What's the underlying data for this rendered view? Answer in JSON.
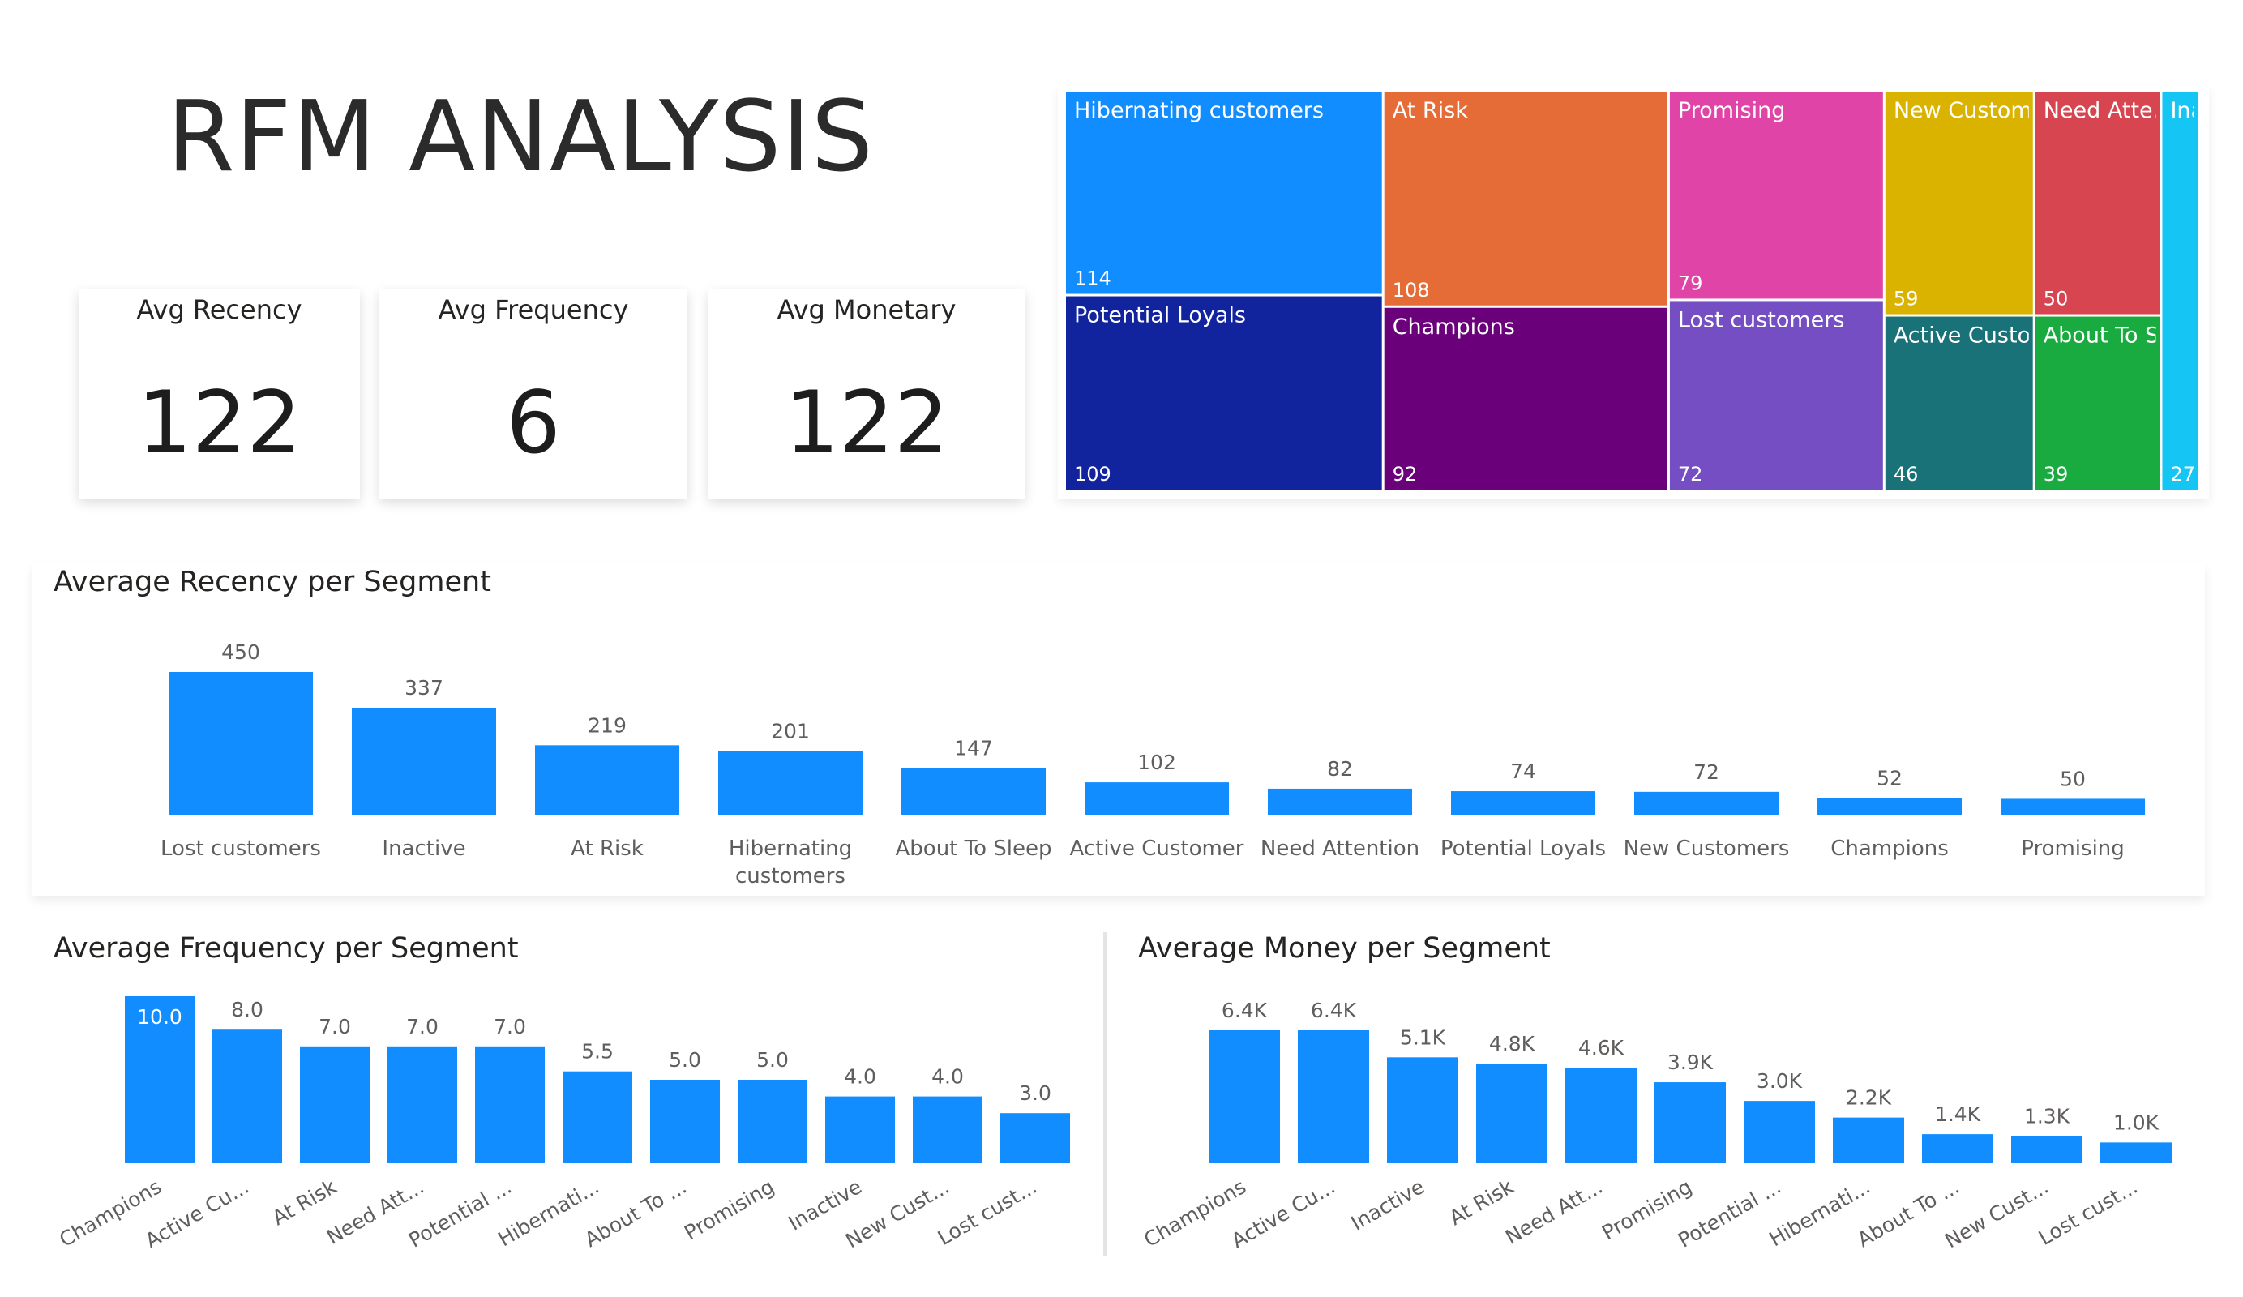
{
  "page": {
    "title": "RFM ANALYSIS"
  },
  "cards": [
    {
      "label": "Avg Recency",
      "value": "122"
    },
    {
      "label": "Avg Frequency",
      "value": "6"
    },
    {
      "label": "Avg Monetary",
      "value": "122"
    }
  ],
  "colors": {
    "bar": "#118DFF",
    "label": "#605E5C",
    "dark": "#252423"
  },
  "chart_data": [
    {
      "type": "treemap",
      "items": [
        {
          "label": "Hibernating customers",
          "value": 114,
          "color": "#118DFF"
        },
        {
          "label": "Potential Loyals",
          "value": 109,
          "color": "#12239E"
        },
        {
          "label": "At Risk",
          "value": 108,
          "color": "#E66C37"
        },
        {
          "label": "Champions",
          "value": 92,
          "color": "#6B007B"
        },
        {
          "label": "Promising",
          "value": 79,
          "color": "#E044A7"
        },
        {
          "label": "Lost customers",
          "value": 72,
          "color": "#744EC2"
        },
        {
          "label": "New Custom...",
          "value": 59,
          "color": "#D9B300"
        },
        {
          "label": "Need Atte...",
          "value": 50,
          "color": "#D64550"
        },
        {
          "label": "Active Customer",
          "value": 46,
          "color": "#197278"
        },
        {
          "label": "About To Sleep",
          "value": 39,
          "color": "#1AAB40"
        },
        {
          "label": "Inac...",
          "value": 27,
          "color": "#15C6F4"
        }
      ]
    },
    {
      "type": "bar",
      "title": "Average Recency per Segment",
      "categories": [
        [
          "Lost customers"
        ],
        [
          "Inactive"
        ],
        [
          "At Risk"
        ],
        [
          "Hibernating",
          "customers"
        ],
        [
          "About To Sleep"
        ],
        [
          "Active Customer"
        ],
        [
          "Need Attention"
        ],
        [
          "Potential Loyals"
        ],
        [
          "New Customers"
        ],
        [
          "Champions"
        ],
        [
          "Promising"
        ]
      ],
      "values": [
        450,
        337,
        219,
        201,
        147,
        102,
        82,
        74,
        72,
        52,
        50
      ],
      "labels": [
        "450",
        "337",
        "219",
        "201",
        "147",
        "102",
        "82",
        "74",
        "72",
        "52",
        "50"
      ]
    },
    {
      "type": "bar",
      "title": "Average Frequency per Segment",
      "categories": [
        "Champions",
        "Active Cu...",
        "At Risk",
        "Need Att...",
        "Potential ...",
        "Hibernati...",
        "About To ...",
        "Promising",
        "Inactive",
        "New Cust...",
        "Lost cust..."
      ],
      "values": [
        10.0,
        8.0,
        7.0,
        7.0,
        7.0,
        5.5,
        5.0,
        5.0,
        4.0,
        4.0,
        3.0
      ],
      "labels": [
        "10.0",
        "8.0",
        "7.0",
        "7.0",
        "7.0",
        "5.5",
        "5.0",
        "5.0",
        "4.0",
        "4.0",
        "3.0"
      ]
    },
    {
      "type": "bar",
      "title": "Average Money per Segment",
      "categories": [
        "Champions",
        "Active Cu...",
        "Inactive",
        "At Risk",
        "Need Att...",
        "Promising",
        "Potential ...",
        "Hibernati...",
        "About To ...",
        "New Cust...",
        "Lost cust..."
      ],
      "values": [
        6400,
        6400,
        5100,
        4800,
        4600,
        3900,
        3000,
        2200,
        1400,
        1300,
        1000
      ],
      "labels": [
        "6.4K",
        "6.4K",
        "5.1K",
        "4.8K",
        "4.6K",
        "3.9K",
        "3.0K",
        "2.2K",
        "1.4K",
        "1.3K",
        "1.0K"
      ]
    }
  ]
}
